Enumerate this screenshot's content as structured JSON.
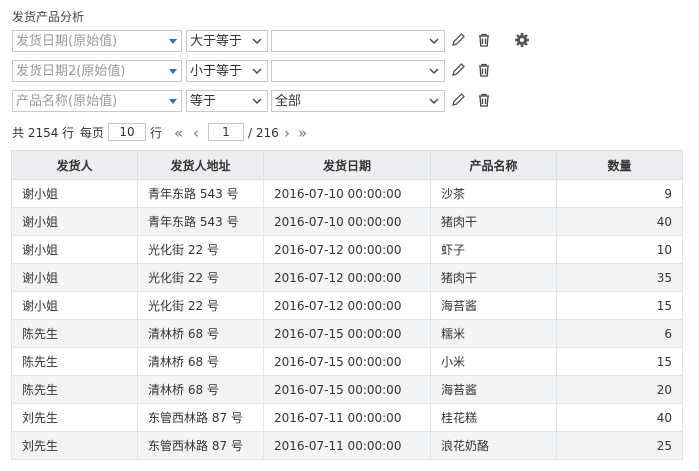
{
  "title": "发货产品分析",
  "filters": [
    {
      "field": "发货日期(原始值)",
      "operator": "大于等于",
      "value": ""
    },
    {
      "field": "发货日期2(原始值)",
      "operator": "小于等于",
      "value": ""
    },
    {
      "field": "产品名称(原始值)",
      "operator": "等于",
      "value": "全部"
    }
  ],
  "pager": {
    "total_label": "共 2154 行",
    "per_page_prefix": "每页",
    "per_page": "10",
    "per_page_suffix": "行",
    "first": "«",
    "prev": "‹",
    "current_page": "1",
    "total_pages": "/ 216",
    "next": "›",
    "last": "»"
  },
  "table": {
    "columns": [
      "发货人",
      "发货人地址",
      "发货日期",
      "产品名称",
      "数量"
    ],
    "rows": [
      [
        "谢小姐",
        "青年东路  543  号",
        "2016-07-10  00:00:00",
        "沙茶",
        "9"
      ],
      [
        "谢小姐",
        "青年东路  543  号",
        "2016-07-10  00:00:00",
        "猪肉干",
        "40"
      ],
      [
        "谢小姐",
        "光化街  22  号",
        "2016-07-12  00:00:00",
        "虾子",
        "10"
      ],
      [
        "谢小姐",
        "光化街  22  号",
        "2016-07-12  00:00:00",
        "猪肉干",
        "35"
      ],
      [
        "谢小姐",
        "光化街  22  号",
        "2016-07-12  00:00:00",
        "海苔酱",
        "15"
      ],
      [
        "陈先生",
        "清林桥  68  号",
        "2016-07-15  00:00:00",
        "糯米",
        "6"
      ],
      [
        "陈先生",
        "清林桥  68  号",
        "2016-07-15  00:00:00",
        "小米",
        "15"
      ],
      [
        "陈先生",
        "清林桥  68  号",
        "2016-07-15  00:00:00",
        "海苔酱",
        "20"
      ],
      [
        "刘先生",
        "东管西林路  87  号",
        "2016-07-11  00:00:00",
        "桂花糕",
        "40"
      ],
      [
        "刘先生",
        "东管西林路  87  号",
        "2016-07-11  00:00:00",
        "浪花奶酪",
        "25"
      ]
    ]
  },
  "colors": {
    "accent": "#1e73be",
    "header_bg": "#eceef1",
    "alt_row": "#f3f4f6"
  },
  "icons": [
    "pencil-icon",
    "trash-icon",
    "gear-icon",
    "chevron-down-icon",
    "caret-down-icon"
  ]
}
